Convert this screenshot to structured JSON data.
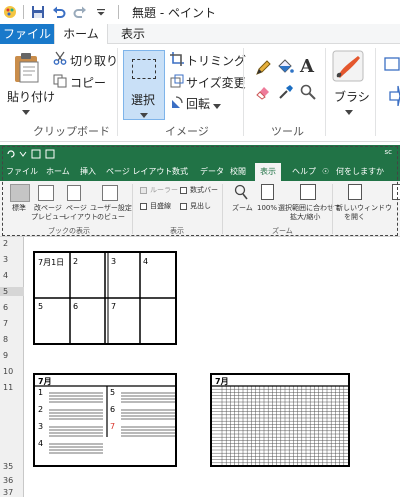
{
  "paint": {
    "window_title": "無題 - ペイント",
    "tabs": {
      "file": "ファイル",
      "home": "ホーム",
      "view": "表示"
    },
    "clipboard": {
      "paste": "貼り付け",
      "cut": "切り取り",
      "copy": "コピー",
      "group": "クリップボード"
    },
    "image": {
      "select": "選択",
      "trim": "トリミング",
      "resize": "サイズ変更",
      "rotate": "回転",
      "group": "イメージ"
    },
    "tools": {
      "group": "ツール",
      "text_tool": "A"
    },
    "brush": "ブラシ"
  },
  "excel": {
    "account": "sc",
    "tabs": [
      "ファイル",
      "ホーム",
      "挿入",
      "ページ レイアウト",
      "数式",
      "データ",
      "校閲",
      "表示",
      "ヘルプ",
      "何をしますか"
    ],
    "active_tab": "表示",
    "workbook_views": {
      "normal": "標準",
      "page_break_1": "改ページ",
      "page_break_2": "プレビュー",
      "page_layout_1": "ページ",
      "page_layout_2": "レイアウト",
      "custom_1": "ユーザー設定",
      "custom_2": "のビュー",
      "group": "ブックの表示"
    },
    "show": {
      "ruler": "ルーラー",
      "formula_bar": "数式バー",
      "gridlines": "目盛線",
      "headings": "見出し",
      "group": "表示"
    },
    "zoom": {
      "zoom": "ズーム",
      "hundred": "100%",
      "zoom_sel_1": "選択範囲に合わせて",
      "zoom_sel_2": "拡大/縮小",
      "group": "ズーム"
    },
    "window": {
      "new_window_1": "新しいウィンドウ",
      "new_window_2": "を開く"
    },
    "row_numbers": [
      "2",
      "3",
      "4",
      "5",
      "6",
      "7",
      "8",
      "9",
      "10",
      "11",
      "35",
      "36",
      "37"
    ],
    "calendar_big": {
      "cells": [
        "7月1日",
        "2",
        "3",
        "4",
        "5",
        "6",
        "7",
        ""
      ]
    },
    "calendar_list": {
      "title": "7月",
      "left": [
        "1",
        "2",
        "3",
        "4"
      ],
      "right": [
        "5",
        "6",
        "7"
      ]
    },
    "calendar_grid": {
      "title": "7月"
    }
  },
  "colors": {
    "paint_blue": "#1979ca",
    "excel_green": "#217346",
    "select_bg": "#c9e0f7",
    "red_digit": "#d9342b"
  }
}
